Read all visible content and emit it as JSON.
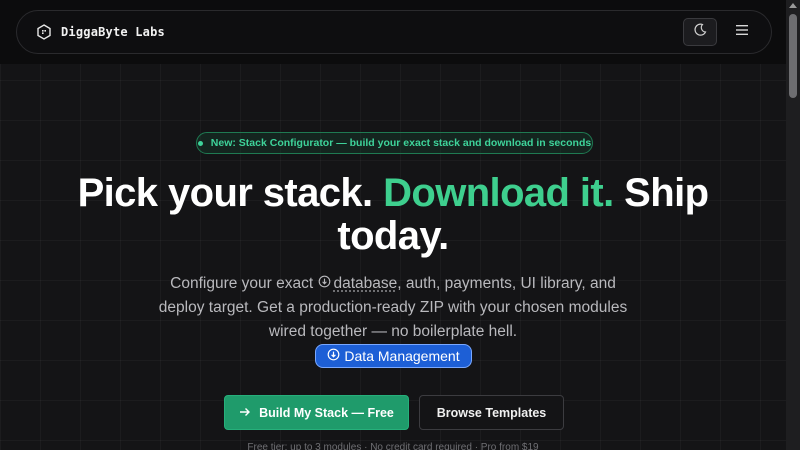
{
  "brand": {
    "name": "DiggaByte Labs",
    "icon": "brand-logo-icon"
  },
  "nav": {
    "theme_toggle_icon": "moon-icon",
    "menu_icon": "hamburger-menu-icon"
  },
  "announcement": {
    "text": "New: Stack Configurator — build your exact stack and download in seconds"
  },
  "hero": {
    "headline_part1": "Pick your stack.",
    "headline_accent": "Download it.",
    "headline_part2": "Ship today.",
    "accent_color": "#3ecf8e",
    "sub_prefix": "Configure your exact",
    "sub_database": "database",
    "sub_suffix": ", auth, payments, UI library, and deploy target. Get a production-ready ZIP with your chosen modules wired together — no boilerplate hell."
  },
  "tooltip": {
    "label": "Data Management",
    "icon": "circle-arrow-icon"
  },
  "cta": {
    "primary_label": "Build My Stack — Free",
    "primary_icon": "arrow-right-icon",
    "secondary_label": "Browse Templates"
  },
  "footnote": "Free tier: up to 3 modules · No credit card required · Pro from $19"
}
